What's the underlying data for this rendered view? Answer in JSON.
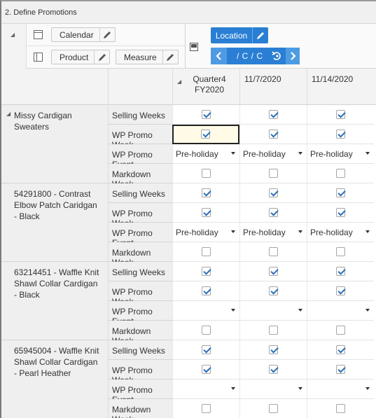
{
  "window": {
    "title": "2. Define Promotions"
  },
  "toolbar": {
    "calendar_label": "Calendar",
    "product_label": "Product",
    "measure_label": "Measure",
    "location_label": "Location",
    "nav_path": "/ C / C"
  },
  "grid": {
    "columns": [
      "Quarter4\nFY2020",
      "11/7/2020",
      "11/14/2020"
    ],
    "measures": [
      "Selling Weeks",
      "WP Promo Week",
      "WP Promo Event",
      "Markdown Week"
    ],
    "products": [
      {
        "name": "Missy Cardigan Sweaters",
        "expand_marker": true,
        "rows": [
          {
            "measure": "Selling Weeks",
            "type": "checkbox",
            "values": [
              true,
              true,
              true
            ]
          },
          {
            "measure": "WP Promo Week",
            "type": "checkbox",
            "values": [
              true,
              true,
              true
            ],
            "selected_col": 0
          },
          {
            "measure": "WP Promo Event",
            "type": "dropdown",
            "values": [
              "Pre-holiday",
              "Pre-holiday",
              "Pre-holiday"
            ]
          },
          {
            "measure": "Markdown Week",
            "type": "checkbox",
            "values": [
              false,
              false,
              false
            ]
          }
        ]
      },
      {
        "name": "54291800 - Contrast Elbow Patch Caridgan - Black",
        "rows": [
          {
            "measure": "Selling Weeks",
            "type": "checkbox",
            "values": [
              true,
              true,
              true
            ]
          },
          {
            "measure": "WP Promo Week",
            "type": "checkbox",
            "values": [
              true,
              true,
              true
            ]
          },
          {
            "measure": "WP Promo Event",
            "type": "dropdown",
            "values": [
              "Pre-holiday",
              "Pre-holiday",
              "Pre-holiday"
            ]
          },
          {
            "measure": "Markdown Week",
            "type": "checkbox",
            "values": [
              false,
              false,
              false
            ]
          }
        ]
      },
      {
        "name": "63214451 - Waffle Knit Shawl Collar Cardigan - Black",
        "rows": [
          {
            "measure": "Selling Weeks",
            "type": "checkbox",
            "values": [
              true,
              true,
              true
            ]
          },
          {
            "measure": "WP Promo Week",
            "type": "checkbox",
            "values": [
              true,
              true,
              true
            ]
          },
          {
            "measure": "WP Promo Event",
            "type": "dropdown",
            "values": [
              "",
              "",
              ""
            ]
          },
          {
            "measure": "Markdown Week",
            "type": "checkbox",
            "values": [
              false,
              false,
              false
            ]
          }
        ]
      },
      {
        "name": "65945004 - Waffle Knit Shawl Collar Cardigan - Pearl Heather",
        "rows": [
          {
            "measure": "Selling Weeks",
            "type": "checkbox",
            "values": [
              true,
              true,
              true
            ]
          },
          {
            "measure": "WP Promo Week",
            "type": "checkbox",
            "values": [
              true,
              true,
              true
            ]
          },
          {
            "measure": "WP Promo Event",
            "type": "dropdown",
            "values": [
              "",
              "",
              ""
            ]
          },
          {
            "measure": "Markdown Week",
            "type": "checkbox",
            "values": [
              false,
              false,
              false
            ]
          }
        ]
      }
    ]
  },
  "colors": {
    "accent": "#2a7fd4",
    "check": "#2a6fb6",
    "selected_cell": "#fffbe6"
  }
}
